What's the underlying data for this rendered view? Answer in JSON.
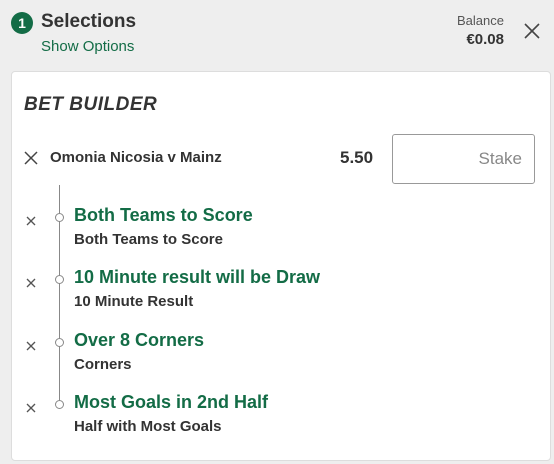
{
  "header": {
    "count": "1",
    "title": "Selections",
    "show_options": "Show Options",
    "balance_label": "Balance",
    "balance_value": "€0.08"
  },
  "bet_builder": {
    "title": "BET BUILDER",
    "event_name": "Omonia Nicosia v Mainz",
    "odds": "5.50",
    "stake_placeholder": "Stake",
    "stake_value": ""
  },
  "legs": [
    {
      "selection": "Both Teams to Score",
      "market": "Both Teams to Score"
    },
    {
      "selection": "10 Minute result will be Draw",
      "market": "10 Minute Result"
    },
    {
      "selection": "Over 8 Corners",
      "market": "Corners"
    },
    {
      "selection": "Most Goals in 2nd Half",
      "market": "Half with Most Goals"
    }
  ],
  "icons": {
    "close": "close-icon",
    "remove": "remove-icon"
  },
  "colors": {
    "accent": "#136c46",
    "background": "#eeeeee",
    "card": "#ffffff",
    "text": "#333333"
  }
}
